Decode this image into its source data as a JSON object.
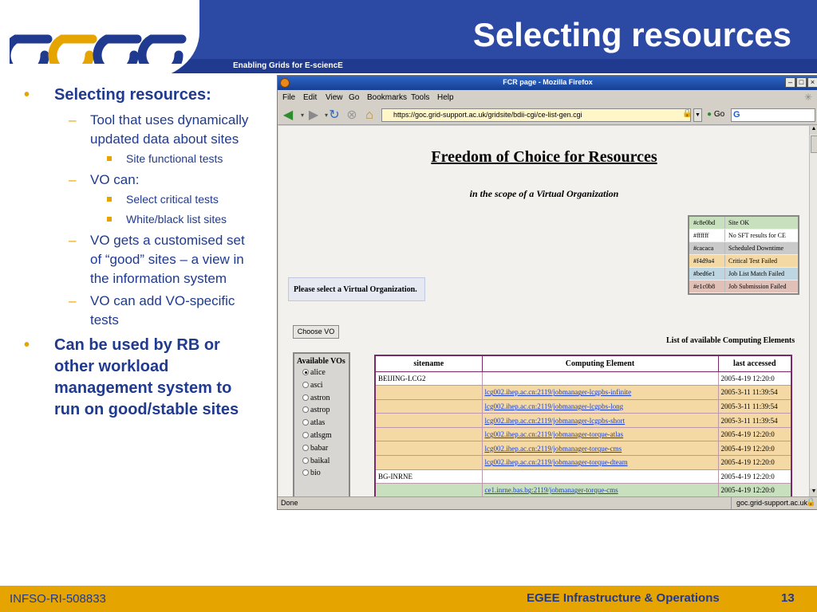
{
  "slide": {
    "title": "Selecting resources",
    "tagline": "Enabling Grids for E-sciencE",
    "footer_left": "INFSO-RI-508833",
    "footer_center": "EGEE Infrastructure & Operations",
    "page_number": "13",
    "colors": {
      "header_blue": "#2c4aa3",
      "accent_orange": "#e6a400",
      "text_blue": "#1f3a8e"
    }
  },
  "bullets": {
    "b1": "Selecting resources:",
    "s1": "Tool that uses dynamically updated data about sites",
    "s1a": "Site functional tests",
    "s2": "VO can:",
    "s2a": "Select critical tests",
    "s2b": "White/black list sites",
    "s3": "VO gets a customised set of “good” sites – a view in the information system",
    "s4": "VO can add VO-specific tests",
    "b2": "Can be used by RB or other workload management system to run on good/stable sites"
  },
  "browser": {
    "window_title": "FCR page - Mozilla Firefox",
    "menu": [
      "File",
      "Edit",
      "View",
      "Go",
      "Bookmarks",
      "Tools",
      "Help"
    ],
    "url": "https://goc.grid-support.ac.uk/gridsite/bdii-cgi/ce-list-gen.cgi",
    "go_label": "Go",
    "status_left": "Done",
    "status_right": "goc.grid-support.ac.uk",
    "icons": [
      "back-arrow-icon",
      "forward-arrow-icon",
      "reload-icon",
      "stop-icon",
      "home-icon",
      "lock-icon",
      "google-icon"
    ]
  },
  "page": {
    "heading": "Freedom of Choice for Resources",
    "subheading": "in the scope of a Virtual Organization",
    "vo_prompt": "Please select a Virtual Organization.",
    "choose_button": "Choose VO",
    "list_caption": "List of available Computing Elements",
    "legend": [
      {
        "code": "#c8e0bd",
        "label": "Site OK",
        "color": "#c8e0bd"
      },
      {
        "code": "#ffffff",
        "label": "No SFT results for CE",
        "color": "#ffffff"
      },
      {
        "code": "#cacaca",
        "label": "Scheduled Downtime",
        "color": "#cacaca"
      },
      {
        "code": "#f4d9a4",
        "label": "Critical Test Failed",
        "color": "#f4d9a4"
      },
      {
        "code": "#bed6e1",
        "label": "Job List Match Failed",
        "color": "#bed6e1"
      },
      {
        "code": "#e1c0b8",
        "label": "Job Submission Failed",
        "color": "#e1c0b8"
      }
    ],
    "vos_header": "Available VOs",
    "vos": [
      "alice",
      "asci",
      "astron",
      "astrop",
      "atlas",
      "atlsgm",
      "babar",
      "baikal",
      "bio"
    ],
    "vo_selected": "alice",
    "table_headers": [
      "sitename",
      "Computing Element",
      "last accessed"
    ],
    "table_rows": [
      {
        "site": "BEIJING-LCG2",
        "ce": "",
        "time": "2005-4-19 12:20:0",
        "color": "#ffffff"
      },
      {
        "site": "",
        "ce": "lcg002.ihep.ac.cn:2119/jobmanager-lcgpbs-infinite",
        "time": "2005-3-11 11:39:54",
        "color": "#f4d9a4"
      },
      {
        "site": "",
        "ce": "lcg002.ihep.ac.cn:2119/jobmanager-lcgpbs-long",
        "time": "2005-3-11 11:39:54",
        "color": "#f4d9a4"
      },
      {
        "site": "",
        "ce": "lcg002.ihep.ac.cn:2119/jobmanager-lcgpbs-short",
        "time": "2005-3-11 11:39:54",
        "color": "#f4d9a4"
      },
      {
        "site": "",
        "ce": "lcg002.ihep.ac.cn:2119/jobmanager-torque-atlas",
        "time": "2005-4-19 12:20:0",
        "color": "#f4d9a4"
      },
      {
        "site": "",
        "ce": "lcg002.ihep.ac.cn:2119/jobmanager-torque-cms",
        "time": "2005-4-19 12:20:0",
        "color": "#f4d9a4"
      },
      {
        "site": "",
        "ce": "lcg002.ihep.ac.cn:2119/jobmanager-torque-dteam",
        "time": "2005-4-19 12:20:0",
        "color": "#f4d9a4"
      },
      {
        "site": "BG-INRNE",
        "ce": "",
        "time": "2005-4-19 12:20:0",
        "color": "#ffffff"
      },
      {
        "site": "",
        "ce": "ce1.inrne.bas.bg:2119/jobmanager-torque-cms",
        "time": "2005-4-19 12:20:0",
        "color": "#c8e0bd"
      }
    ]
  }
}
